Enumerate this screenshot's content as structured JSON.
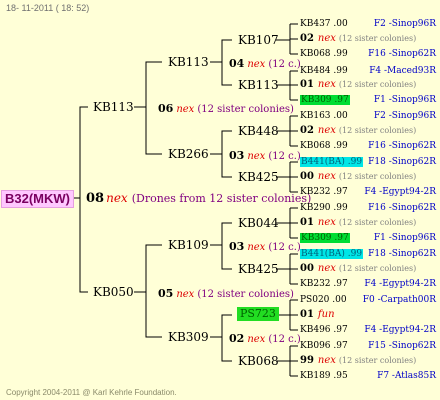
{
  "header": {
    "date": "18- 11-2011 ( 18: 52)"
  },
  "footer": {
    "copyright": "Copyright 2004-2011 @ Karl Kehrle Foundation."
  },
  "root": {
    "label": "B32(MKW)"
  },
  "drone_label": "nex",
  "fun_label": "fun",
  "main": {
    "num": "08",
    "desc": "(Drones from 12 sister colonies)"
  },
  "gen1": {
    "top": {
      "name": "KB113",
      "num": "06",
      "desc": "(12 sister colonies)"
    },
    "bot": {
      "name": "KB050",
      "num": "05",
      "desc": "(12 sister colonies)"
    }
  },
  "gen2": [
    {
      "name": "KB113",
      "num": "04",
      "desc": "(12 c.)"
    },
    {
      "name": "KB266",
      "num": "03",
      "desc": "(12 c.)"
    },
    {
      "name": "KB109",
      "num": "03",
      "desc": "(12 c.)"
    },
    {
      "name": "KB309",
      "num": "02",
      "desc": "(12 c.)"
    }
  ],
  "gen3": [
    {
      "name": "KB107"
    },
    {
      "name": "KB113"
    },
    {
      "name": "KB448"
    },
    {
      "name": "KB425"
    },
    {
      "name": "KB044"
    },
    {
      "name": "KB425"
    },
    {
      "name": "PS723"
    },
    {
      "name": "KB068"
    }
  ],
  "gen4": [
    {
      "kind": "queen",
      "left": "KB437 .00",
      "right": "F2 -Sinop96R"
    },
    {
      "kind": "drone",
      "num": "02",
      "sis": "(12 sister colonies)"
    },
    {
      "kind": "queen",
      "left": "KB068 .99",
      "right": "F16 -Sinop62R"
    },
    {
      "kind": "queen",
      "left": "KB484 .99",
      "right": "F4 -Maced93R"
    },
    {
      "kind": "drone",
      "num": "01",
      "sis": "(12 sister colonies)"
    },
    {
      "kind": "queen",
      "left": "KB309 .97",
      "right": "F1 -Sinop96R",
      "hl": "g"
    },
    {
      "kind": "queen",
      "left": "KB163 .00",
      "right": "F2 -Sinop96R"
    },
    {
      "kind": "drone",
      "num": "02",
      "sis": "(12 sister colonies)"
    },
    {
      "kind": "queen",
      "left": "KB068 .99",
      "right": "F16 -Sinop62R"
    },
    {
      "kind": "queen",
      "left": "B441(BA) .99",
      "right": "F18 -Sinop62R",
      "hl": "c"
    },
    {
      "kind": "drone",
      "num": "00",
      "sis": "(12 sister colonies)"
    },
    {
      "kind": "queen",
      "left": "KB232 .97",
      "right": "F4 -Egypt94-2R"
    },
    {
      "kind": "queen",
      "left": "KB290 .99",
      "right": "F16 -Sinop62R"
    },
    {
      "kind": "drone",
      "num": "01",
      "sis": "(12 sister colonies)"
    },
    {
      "kind": "queen",
      "left": "KB309 .97",
      "right": "F1 -Sinop96R",
      "hl": "g"
    },
    {
      "kind": "queen",
      "left": "B441(BA) .99",
      "right": "F18 -Sinop62R",
      "hl": "c"
    },
    {
      "kind": "drone",
      "num": "00",
      "sis": "(12 sister colonies)"
    },
    {
      "kind": "queen",
      "left": "KB232 .97",
      "right": "F4 -Egypt94-2R"
    },
    {
      "kind": "queen",
      "left": "PS020 .00",
      "right": "F0 -Carpath00R"
    },
    {
      "kind": "fun",
      "num": "01"
    },
    {
      "kind": "queen",
      "left": "KB496 .97",
      "right": "F4 -Egypt94-2R"
    },
    {
      "kind": "queen",
      "left": "KB096 .97",
      "right": "F15 -Sinop62R"
    },
    {
      "kind": "drone",
      "num": "99",
      "sis": "(12 sister colonies)"
    },
    {
      "kind": "queen",
      "left": "KB189 .95",
      "right": "F7 -Atlas85R"
    }
  ],
  "colors": {
    "drone": "#dd0000",
    "sister": "#800080",
    "right_col": "#0000c8",
    "root_bg": "#ffc8ff",
    "highlight_green": "#00dd33",
    "highlight_cyan": "#00e6e6"
  }
}
